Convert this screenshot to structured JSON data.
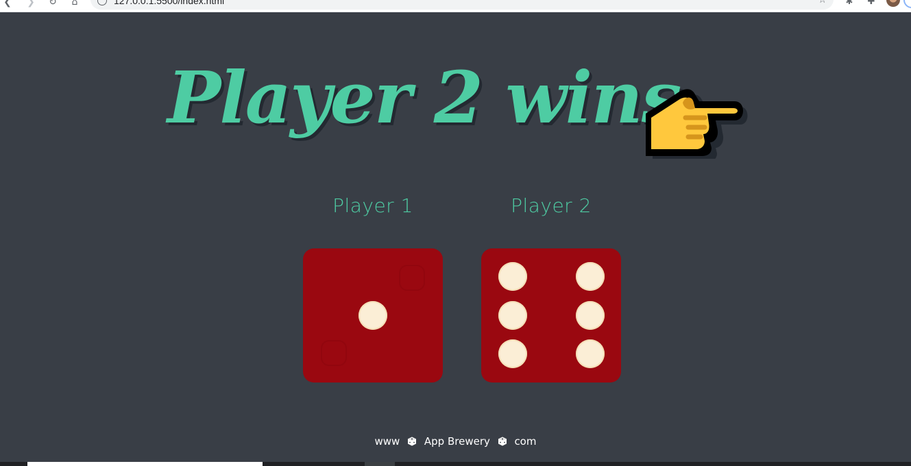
{
  "browser": {
    "url": "127.0.0.1:5500/index.html",
    "icons": [
      "back-icon",
      "forward-icon",
      "reload-icon",
      "home-icon",
      "site-info-icon",
      "bookmark-star-icon",
      "extension-icon",
      "puzzle-icon",
      "profile-avatar"
    ]
  },
  "game": {
    "title": "Player 2 wins",
    "title_icon": "pointing-hand-icon",
    "players": [
      {
        "label": "Player 1",
        "dice_value": 1
      },
      {
        "label": "Player 2",
        "dice_value": 6
      }
    ],
    "footer": {
      "prefix": "www",
      "brand": "App Brewery",
      "suffix": "com"
    }
  },
  "colors": {
    "background": "#393e46",
    "accent": "#4ecca3",
    "dice": "#9a0810",
    "pip": "#fbeed6",
    "hand": "#ffc83d"
  }
}
